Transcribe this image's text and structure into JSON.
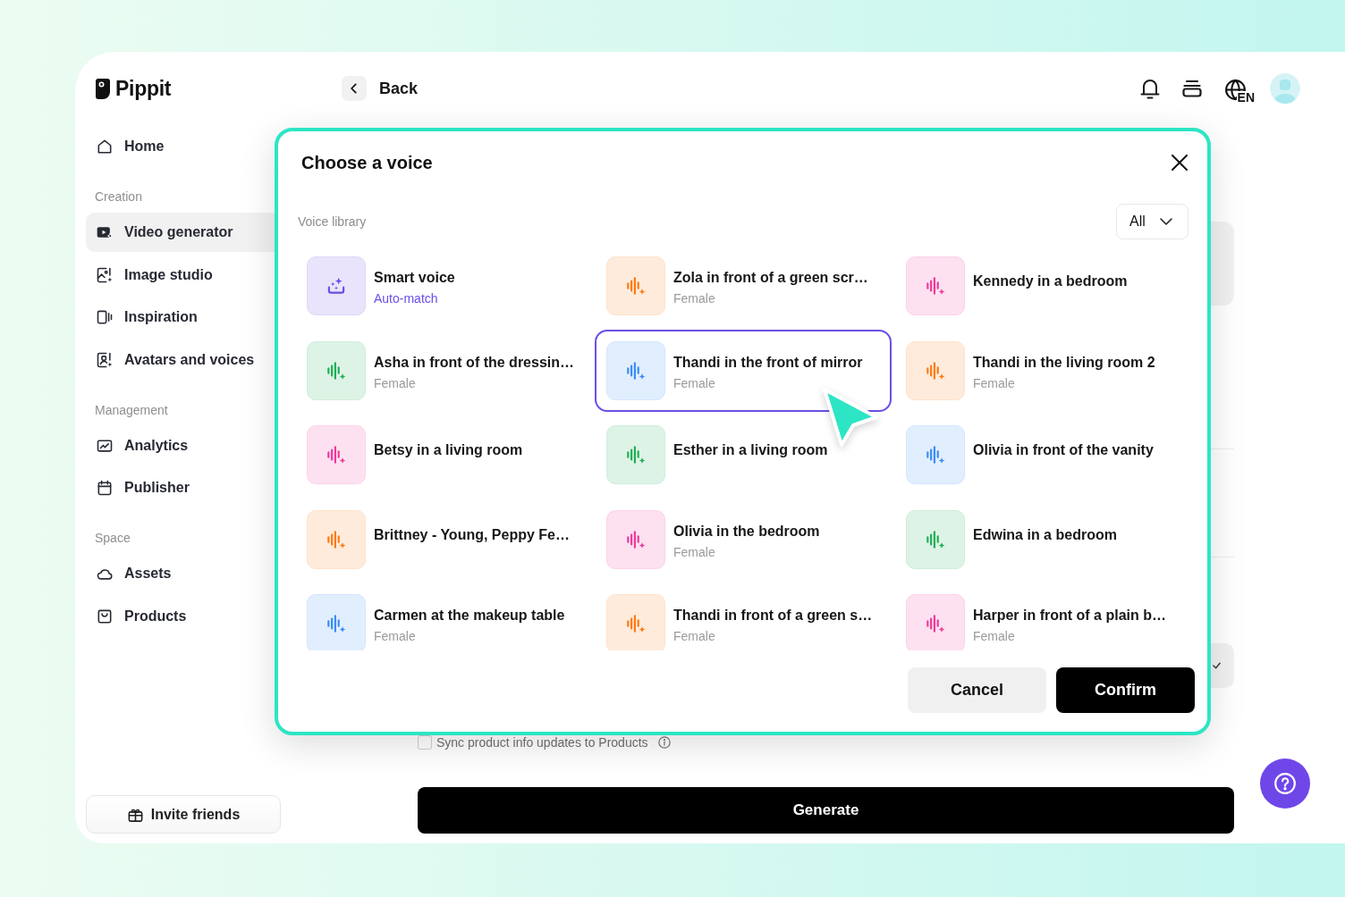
{
  "sidebar": {
    "brand": "Pippit",
    "sections": [
      {
        "items": [
          {
            "label": "Home",
            "selected": false
          }
        ]
      },
      {
        "title": "Creation",
        "items": [
          {
            "label": "Video generator",
            "selected": true
          },
          {
            "label": "Image studio",
            "selected": false
          },
          {
            "label": "Inspiration",
            "selected": false
          },
          {
            "label": "Avatars and voices",
            "selected": false
          }
        ]
      },
      {
        "title": "Management",
        "items": [
          {
            "label": "Analytics",
            "selected": false
          },
          {
            "label": "Publisher",
            "selected": false
          }
        ]
      },
      {
        "title": "Space",
        "items": [
          {
            "label": "Assets",
            "selected": false
          },
          {
            "label": "Products",
            "selected": false
          }
        ]
      }
    ],
    "invite_button": "Invite friends"
  },
  "top_bar": {
    "back": "Back",
    "language": "EN"
  },
  "page": {
    "sync_option": {
      "label": "Sync product info updates to Products",
      "checked": false
    },
    "generate_button": "Generate"
  },
  "dialog": {
    "title": "Choose a voice",
    "section_label": "Voice library",
    "filter": "All",
    "voices": [
      {
        "name": "Smart voice",
        "subtitle": "Auto-match",
        "kind": "smart",
        "color": "#6b4ee6",
        "selected": false
      },
      {
        "name": "Zola in front of a green scr…",
        "subtitle": "Female",
        "kind": "voice",
        "color": "#ff7a12",
        "selected": false
      },
      {
        "name": "Kennedy in a bedroom",
        "kind": "voice",
        "color": "#f0399b",
        "selected": false
      },
      {
        "name": "Asha in front of the dressin…",
        "subtitle": "Female",
        "kind": "voice",
        "color": "#1fae55",
        "selected": false
      },
      {
        "name": "Thandi in the front of mirror",
        "subtitle": "Female",
        "kind": "voice",
        "color": "#3a8cf6",
        "selected": true
      },
      {
        "name": "Thandi in the living room 2",
        "subtitle": "Female",
        "kind": "voice",
        "color": "#ff7a12",
        "selected": false
      },
      {
        "name": "Betsy in a living room",
        "kind": "voice",
        "color": "#f0399b",
        "selected": false
      },
      {
        "name": "Esther in a living room",
        "kind": "voice",
        "color": "#1fae55",
        "selected": false
      },
      {
        "name": "Olivia in front of the vanity",
        "kind": "voice",
        "color": "#3a8cf6",
        "selected": false
      },
      {
        "name": "Brittney - Young, Peppy Fe…",
        "kind": "voice",
        "color": "#ff7a12",
        "selected": false
      },
      {
        "name": "Olivia in the bedroom",
        "subtitle": "Female",
        "kind": "voice",
        "color": "#f0399b",
        "selected": false
      },
      {
        "name": "Edwina in a bedroom",
        "kind": "voice",
        "color": "#1fae55",
        "selected": false
      },
      {
        "name": "Carmen at the makeup table",
        "subtitle": "Female",
        "kind": "voice",
        "color": "#3a8cf6",
        "selected": false
      },
      {
        "name": "Thandi in front of a green s…",
        "subtitle": "Female",
        "kind": "voice",
        "color": "#ff7a12",
        "selected": false
      },
      {
        "name": "Harper in front of a plain b…",
        "subtitle": "Female",
        "kind": "voice",
        "color": "#f0399b",
        "selected": false
      }
    ],
    "buttons": [
      {
        "label": "Cancel",
        "kind": "secondary"
      },
      {
        "label": "Confirm",
        "kind": "primary"
      }
    ]
  }
}
